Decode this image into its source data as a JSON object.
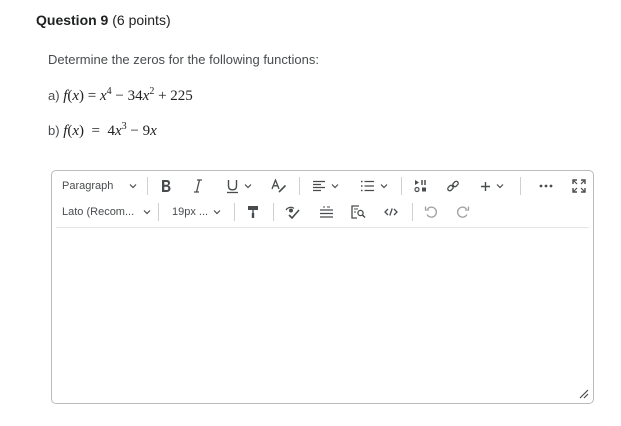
{
  "question": {
    "title": "Question 9",
    "points": "(6 points)"
  },
  "prompt": "Determine the zeros for the following functions:",
  "functions": {
    "a": {
      "label": "a)",
      "lhs_f": "f",
      "lhs_x": "x",
      "rhs_x1": "x",
      "rhs_exp1": "4",
      "rhs_mid": " − 34",
      "rhs_x2": "x",
      "rhs_exp2": "2",
      "rhs_end": " + 225"
    },
    "b": {
      "label": "b)",
      "lhs_f": "f",
      "lhs_x": "x",
      "rhs_coef": "4",
      "rhs_x1": "x",
      "rhs_exp1": "3",
      "rhs_mid": " − 9",
      "rhs_x2": "x"
    }
  },
  "editor": {
    "block_format": "Paragraph",
    "font_family": "Lato (Recom...",
    "font_size": "19px ...",
    "icons": [
      "bold-icon",
      "italic-icon",
      "underline-icon",
      "text-style-icon",
      "align-icon",
      "list-icon",
      "insert-media-icon",
      "link-icon",
      "add-icon",
      "more-icon",
      "fullscreen-icon",
      "format-painter-icon",
      "accessibility-checker-icon",
      "equation-icon",
      "find-replace-icon",
      "source-code-icon",
      "undo-icon",
      "redo-icon",
      "resize-icon"
    ],
    "content": ""
  },
  "colors": {
    "text": "#494c4e",
    "heading": "#202122",
    "border": "#b8bcbf"
  }
}
